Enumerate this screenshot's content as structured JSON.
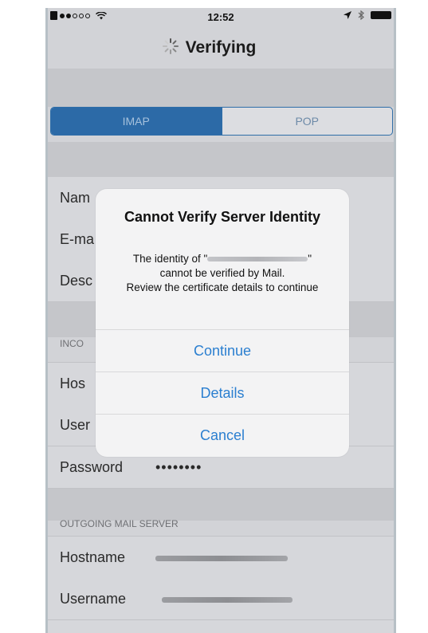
{
  "status_bar": {
    "time": "12:52"
  },
  "nav": {
    "title": "Verifying"
  },
  "segmented": {
    "imap": "IMAP",
    "pop": "POP"
  },
  "account_rows": [
    {
      "label": "Nam"
    },
    {
      "label": "E-ma"
    },
    {
      "label": "Desc"
    }
  ],
  "incoming": {
    "header": "INCO",
    "rows": [
      {
        "label": "Hos"
      },
      {
        "label": "User"
      },
      {
        "label": "Password",
        "value": "••••••••"
      }
    ]
  },
  "outgoing": {
    "header": "OUTGOING MAIL SERVER",
    "rows": [
      {
        "label": "Hostname"
      },
      {
        "label": "Username"
      }
    ]
  },
  "alert": {
    "title": "Cannot Verify Server Identity",
    "message_prefix": "The identity of \"",
    "message_suffix": "\"",
    "message_line2": "cannot be verified by Mail.",
    "message_line3": "Review the certificate details to continue",
    "buttons": {
      "continue": "Continue",
      "details": "Details",
      "cancel": "Cancel"
    }
  },
  "colors": {
    "accent": "#2b7fd0",
    "segment_active": "#2c6aa7"
  }
}
